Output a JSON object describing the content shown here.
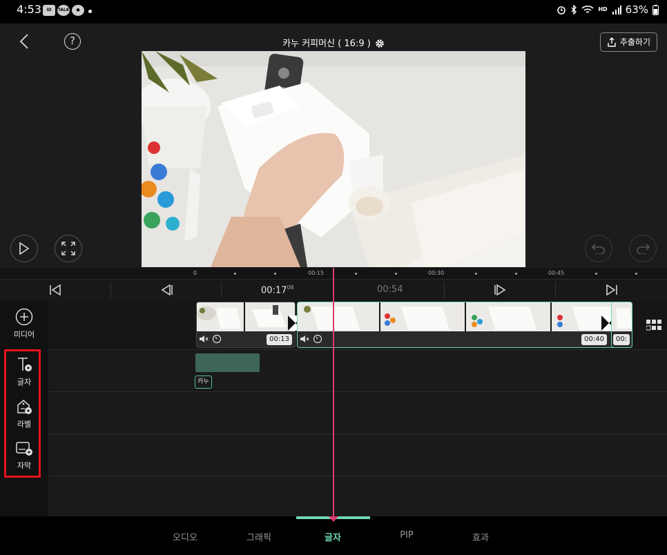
{
  "status_bar": {
    "time": "4:53",
    "app_icons": [
      "notification-icon",
      "kakaotalk-icon",
      "app-icon"
    ],
    "battery": "63%",
    "network": "HD",
    "system_icons": [
      "alarm-icon",
      "bluetooth-icon",
      "wifi-icon",
      "signal-icon",
      "battery-icon"
    ]
  },
  "top_bar": {
    "project_title": "카누 커피머신 ( 16:9 )",
    "export_label": "추출하기"
  },
  "ruler": {
    "labels": [
      "0",
      "00:15",
      "00:30",
      "00:45"
    ]
  },
  "transport": {
    "current_time": "00:17",
    "current_frames": "08",
    "total_time": "00:54"
  },
  "side_tools": {
    "media_label": "미디어",
    "text_label": "글자",
    "label_label": "라벨",
    "subtitle_label": "자막"
  },
  "clips": {
    "clip1_duration": "00:13",
    "clip2_duration": "00:40",
    "clip3_duration": "00:"
  },
  "text_layer": {
    "tag": "카누"
  },
  "tabs": [
    {
      "label": "오디오"
    },
    {
      "label": "그래픽"
    },
    {
      "label": "글자"
    },
    {
      "label": "PIP"
    },
    {
      "label": "효과"
    }
  ],
  "colors": {
    "accent": "#6fd6b1",
    "playhead": "#e03a6e",
    "highlight": "#e5141b",
    "text_clip": "#3e6656"
  }
}
